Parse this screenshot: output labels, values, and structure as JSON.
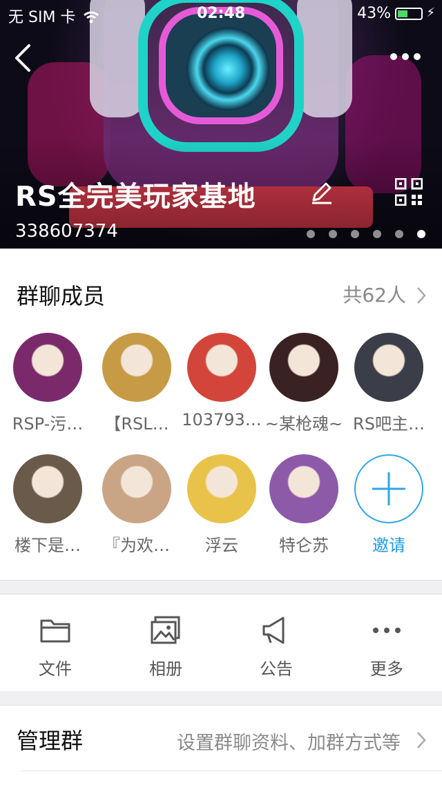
{
  "status_bar": {
    "carrier": "无 SIM 卡",
    "time": "02:48",
    "battery_pct": "43%"
  },
  "group": {
    "name": "RS全完美玩家基地",
    "id": "338607374",
    "banner_pages": 6,
    "banner_active": 5
  },
  "members": {
    "title": "群聊成员",
    "count_label": "共62人",
    "list": [
      {
        "name": "RSP-污…",
        "color": "#7a2a6a"
      },
      {
        "name": "【RSL…",
        "color": "#c79a45"
      },
      {
        "name": "103793…",
        "color": "#d3453a"
      },
      {
        "name": "~某枪魂~",
        "color": "#3a2222"
      },
      {
        "name": "RS吧主…",
        "color": "#3b3d48"
      },
      {
        "name": "楼下是…",
        "color": "#6a5a4a"
      },
      {
        "name": "『为欢…",
        "color": "#c9a585"
      },
      {
        "name": "浮云",
        "color": "#e9c24a"
      },
      {
        "name": "特仑苏",
        "color": "#8c5aa8"
      }
    ],
    "invite_label": "邀请"
  },
  "tools": [
    {
      "label": "文件",
      "icon": "folder-icon"
    },
    {
      "label": "相册",
      "icon": "photo-album-icon"
    },
    {
      "label": "公告",
      "icon": "megaphone-icon"
    },
    {
      "label": "更多",
      "icon": "more-dots-icon"
    }
  ],
  "manage": {
    "title": "管理群",
    "desc": "设置群聊资料、加群方式等"
  },
  "colors": {
    "accent": "#1b9be6",
    "battery": "#4cd964"
  }
}
